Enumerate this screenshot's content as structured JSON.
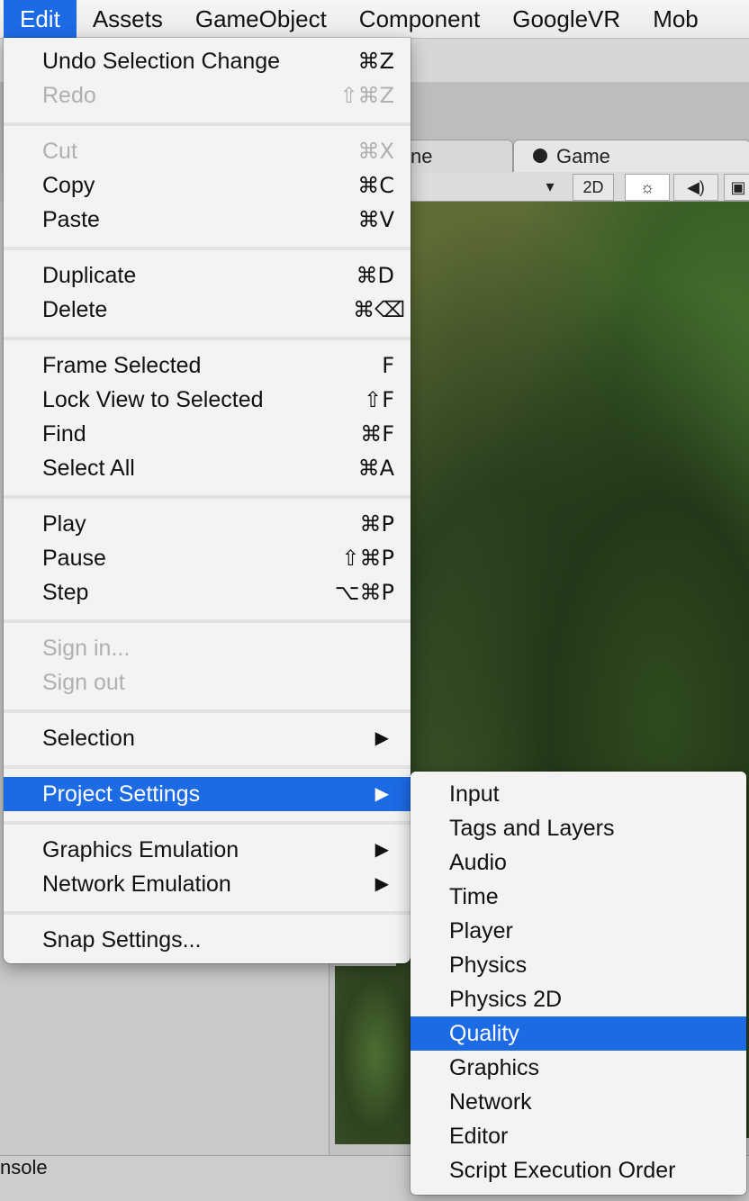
{
  "menubar": {
    "items": [
      "Edit",
      "Assets",
      "GameObject",
      "Component",
      "GoogleVR",
      "Mob"
    ],
    "active_index": 0
  },
  "editor": {
    "tab_scene_partial": "ne",
    "tab_game": "Game",
    "btn_2d": "2D",
    "console_partial": "nsole"
  },
  "edit_menu": {
    "items": [
      {
        "label": "Undo Selection Change",
        "shortcut": "⌘Z",
        "enabled": true
      },
      {
        "label": "Redo",
        "shortcut": "⇧⌘Z",
        "enabled": false
      },
      {
        "label": "Cut",
        "shortcut": "⌘X",
        "enabled": false
      },
      {
        "label": "Copy",
        "shortcut": "⌘C",
        "enabled": true
      },
      {
        "label": "Paste",
        "shortcut": "⌘V",
        "enabled": true
      },
      {
        "label": "Duplicate",
        "shortcut": "⌘D",
        "enabled": true
      },
      {
        "label": "Delete",
        "shortcut": "⌘⌫",
        "enabled": true
      },
      {
        "label": "Frame Selected",
        "shortcut": "F",
        "enabled": true
      },
      {
        "label": "Lock View to Selected",
        "shortcut": "⇧F",
        "enabled": true
      },
      {
        "label": "Find",
        "shortcut": "⌘F",
        "enabled": true
      },
      {
        "label": "Select All",
        "shortcut": "⌘A",
        "enabled": true
      },
      {
        "label": "Play",
        "shortcut": "⌘P",
        "enabled": true
      },
      {
        "label": "Pause",
        "shortcut": "⇧⌘P",
        "enabled": true
      },
      {
        "label": "Step",
        "shortcut": "⌥⌘P",
        "enabled": true
      },
      {
        "label": "Sign in...",
        "shortcut": "",
        "enabled": false
      },
      {
        "label": "Sign out",
        "shortcut": "",
        "enabled": false
      },
      {
        "label": "Selection",
        "shortcut": "",
        "enabled": true,
        "submenu": true
      },
      {
        "label": "Project Settings",
        "shortcut": "",
        "enabled": true,
        "submenu": true,
        "highlighted": true
      },
      {
        "label": "Graphics Emulation",
        "shortcut": "",
        "enabled": true,
        "submenu": true
      },
      {
        "label": "Network Emulation",
        "shortcut": "",
        "enabled": true,
        "submenu": true
      },
      {
        "label": "Snap Settings...",
        "shortcut": "",
        "enabled": true
      }
    ],
    "submenu_arrow": "▶"
  },
  "project_settings_submenu": {
    "items": [
      "Input",
      "Tags and Layers",
      "Audio",
      "Time",
      "Player",
      "Physics",
      "Physics 2D",
      "Quality",
      "Graphics",
      "Network",
      "Editor",
      "Script Execution Order"
    ],
    "highlighted_index": 7
  },
  "colors": {
    "highlight": "#1c6ae4",
    "menu_bg": "#f3f3f3",
    "disabled_text": "#b0b0b0"
  }
}
